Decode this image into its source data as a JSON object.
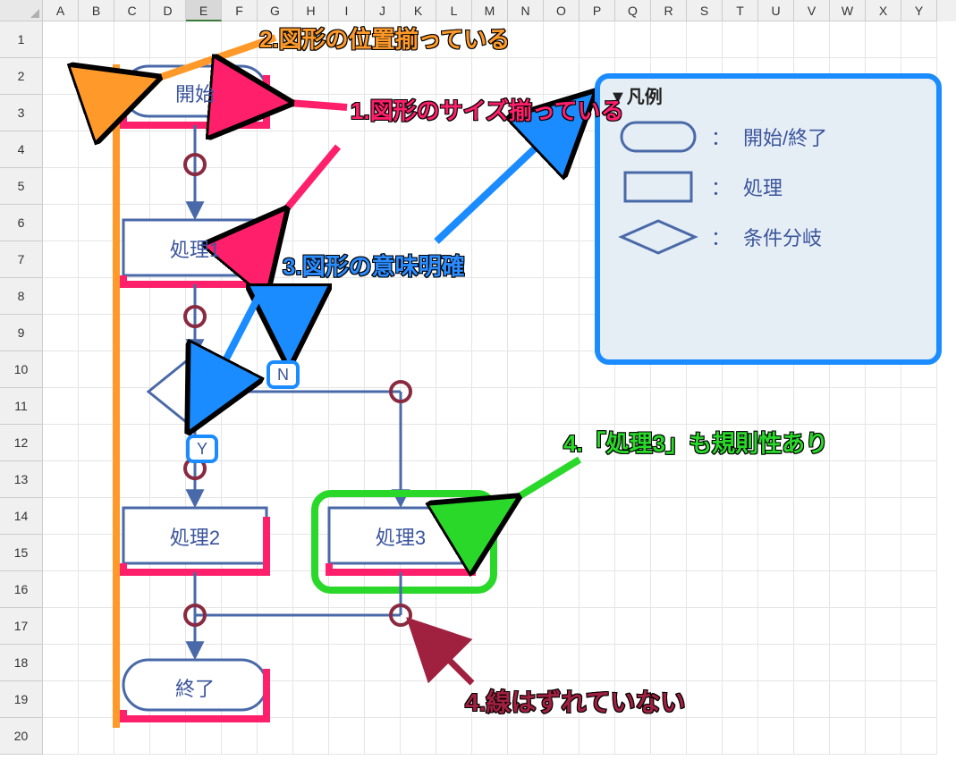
{
  "columns": [
    "A",
    "B",
    "C",
    "D",
    "E",
    "F",
    "G",
    "H",
    "I",
    "J",
    "K",
    "L",
    "M",
    "N",
    "O",
    "P",
    "Q",
    "R",
    "S",
    "T",
    "U",
    "V",
    "W",
    "X",
    "Y"
  ],
  "selected_col": "E",
  "rows": [
    "1",
    "2",
    "3",
    "4",
    "5",
    "6",
    "7",
    "8",
    "9",
    "10",
    "11",
    "12",
    "13",
    "14",
    "15",
    "16",
    "17",
    "18",
    "19",
    "20"
  ],
  "flow": {
    "start": "開始",
    "p1": "処理1",
    "p2": "処理2",
    "p3": "処理3",
    "end": "終了",
    "Y": "Y",
    "N": "N"
  },
  "legend": {
    "title": "▼凡例",
    "start_end": "開始/終了",
    "process": "処理",
    "decision": "条件分岐"
  },
  "annot": {
    "a1": "1.図形のサイズ揃っている",
    "a2": "2.図形の位置揃っている",
    "a3": "3.図形の意味明確",
    "a4a": "4.「処理3」も規則性あり",
    "a4b": "4.線はずれていない"
  }
}
